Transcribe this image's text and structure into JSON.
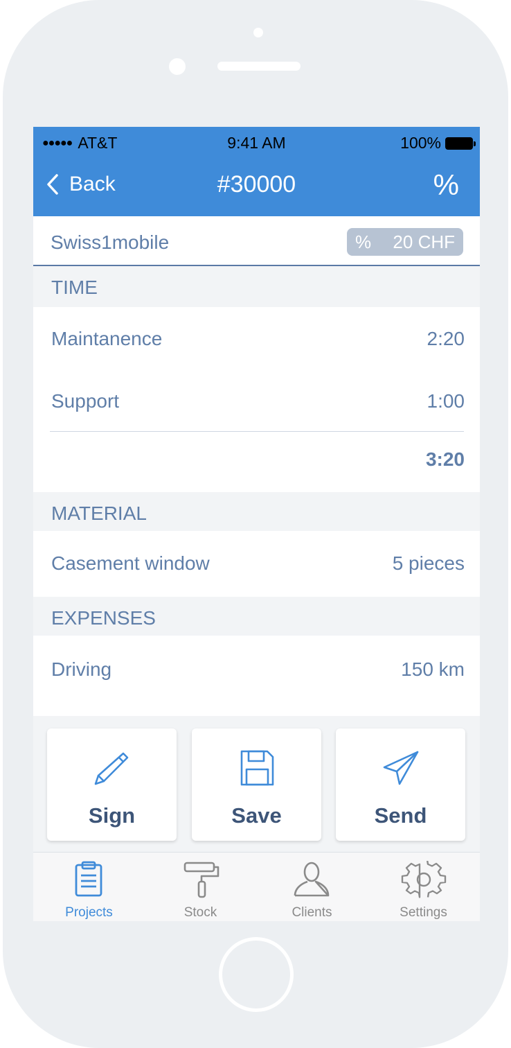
{
  "status_bar": {
    "carrier": "AT&T",
    "time": "9:41 AM",
    "battery": "100%"
  },
  "nav": {
    "back_label": "Back",
    "title": "#30000",
    "action_symbol": "%"
  },
  "client": {
    "name": "Swiss1mobile",
    "discount_symbol": "%",
    "discount_value": "20 CHF"
  },
  "sections": {
    "time": {
      "header": "TIME",
      "items": [
        {
          "label": "Maintanence",
          "value": "2:20"
        },
        {
          "label": "Support",
          "value": "1:00"
        }
      ],
      "total": "3:20"
    },
    "material": {
      "header": "MATERIAL",
      "items": [
        {
          "label": "Casement window",
          "value": "5 pieces"
        }
      ]
    },
    "expenses": {
      "header": "EXPENSES",
      "items": [
        {
          "label": "Driving",
          "value": "150 km"
        }
      ]
    }
  },
  "actions": [
    {
      "label": "Sign",
      "icon": "pencil-icon"
    },
    {
      "label": "Save",
      "icon": "floppy-disk-icon"
    },
    {
      "label": "Send",
      "icon": "paper-plane-icon"
    }
  ],
  "tabs": [
    {
      "label": "Projects",
      "icon": "clipboard-icon",
      "active": true
    },
    {
      "label": "Stock",
      "icon": "paint-roller-icon",
      "active": false
    },
    {
      "label": "Clients",
      "icon": "person-icon",
      "active": false
    },
    {
      "label": "Settings",
      "icon": "gear-icon",
      "active": false
    }
  ],
  "colors": {
    "accent": "#3f8bd9",
    "text": "#5f7ea8",
    "button_text": "#3d5578",
    "section_bg": "#f2f4f6",
    "inactive_tab": "#8a8a8a"
  }
}
